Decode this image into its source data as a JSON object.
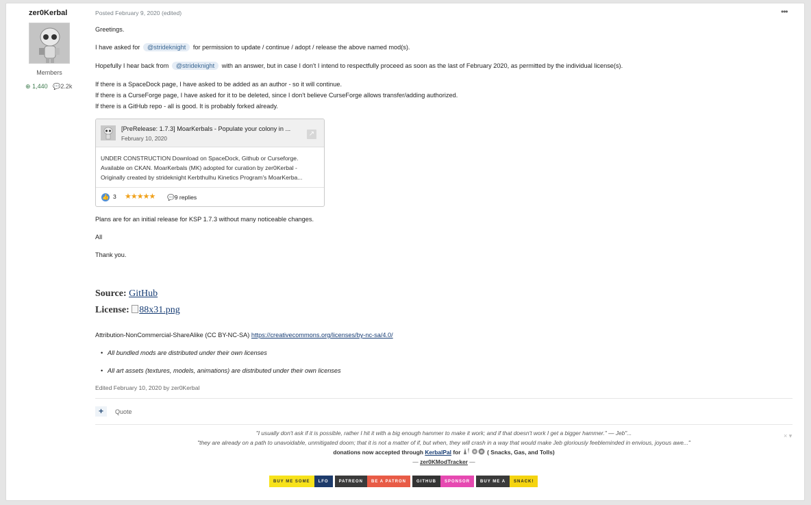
{
  "author": {
    "name": "zer0Kerbal",
    "group": "Members",
    "reputation": "1,440",
    "posts": "2.2k"
  },
  "post": {
    "meta": "Posted February 9, 2020 (edited)",
    "more_label": "•••",
    "greeting": "Greetings.",
    "asked_pre": "I have asked for",
    "asked_mention": "@strideknight",
    "asked_post": "for permission to update / continue / adopt / release the above named mod(s).",
    "hope_pre": "Hopefully I hear back from",
    "hope_mention": "@strideknight",
    "hope_post": "with an answer, but in case I don't I intend to respectfully proceed as soon as the last of February 2020, as permitted by the individual license(s).",
    "line_spacedock": "If there is a SpaceDock page, I have asked to be added as an author - so it will continue.",
    "line_curseforge": "If there is a CurseForge page, I have asked for it to be deleted, since I don't believe CurseForge allows transfer/adding authorized.",
    "line_github": "If there is a GitHub repo - all is good. It is probably forked already.",
    "plans": "Plans are for an initial release for KSP 1.7.3 without many noticeable changes.",
    "all": "All",
    "thanks": "Thank you.",
    "source_label": "Source:",
    "source_link": "GitHub",
    "license_label": "License:",
    "license_img_alt": "88x31.png",
    "attribution_text": "Attribution-NonCommercial-ShareAlike (CC BY-NC-SA)",
    "attribution_link": "https://creativecommons.org/licenses/by-nc-sa/4.0/",
    "bullet1": "All bundled mods are distributed under their own licenses",
    "bullet2": "All art assets (textures, models, animations) are distributed under their own licenses",
    "edited": "Edited February 10, 2020 by zer0Kerbal",
    "quote_label": "Quote",
    "plus_label": "+"
  },
  "embed": {
    "title": "[PreRelease: 1.7.3] MoarKerbals - Populate your colony in ...",
    "date": "February 10, 2020",
    "line1": "UNDER CONSTRUCTION   Download on SpaceDock, Github or Curseforge.",
    "line2": "Available on CKAN. MoarKerbals (MK) adopted for curation by zer0Kerbal -",
    "line3": "Originally created by strideknight Kerbthulhu Kinetics Program's MoarKerba...",
    "likes": "3",
    "stars": "★★★★★",
    "replies": "9 replies"
  },
  "signature": {
    "quote1": "\"I usually don't ask if it is possible, rather I hit it with a big enough hammer to make it work; and if that doesn't work I get a bigger hammer.\"  — Jeb\"...",
    "quote2": "\"they are already on a path to unavoidable, unmitigated doom; that it is not a matter of if, but when, they will crash in a way that would make Jeb gloriously feebleminded in envious, joyous awe...\"",
    "donations_pre": "donations now accepted through",
    "donations_link": "KerbalPal",
    "donations_for": "for",
    "donations_post": "( Snacks, Gas, and Tolls)",
    "tracker_dash_l": "—",
    "tracker_link": "zer0KModTracker",
    "tracker_dash_r": "—",
    "close_label": "× ▾"
  },
  "badges": [
    {
      "left": "BUY ME SOME",
      "right": "LFO",
      "left_color": "#f7e21b",
      "left_text": "#333333",
      "right_color": "#1d3b6b",
      "right_text": "#ffffff"
    },
    {
      "left": "PATREON",
      "right": "BE A PATRON",
      "left_color": "#3a3a3a",
      "left_text": "#ffffff",
      "right_color": "#e85b46",
      "right_text": "#ffffff"
    },
    {
      "left": "GITHUB",
      "right": "SPONSOR",
      "left_color": "#333333",
      "left_text": "#ffffff",
      "right_color": "#e649b1",
      "right_text": "#ffffff"
    },
    {
      "left": "BUY ME A",
      "right": "SNACK!",
      "left_color": "#3a3a3a",
      "left_text": "#ffffff",
      "right_color": "#f5d410",
      "right_text": "#222222"
    }
  ],
  "icons": {
    "reputation": "plus-circle-icon",
    "posts": "comment-icon",
    "replies": "comment-icon",
    "like": "thumbs-up-icon",
    "open": "external-link-icon"
  },
  "colors": {
    "link": "#163c74",
    "mention_bg": "#e4ecf5",
    "reputation": "#3c7a4c",
    "stars": "#f0a11b"
  }
}
